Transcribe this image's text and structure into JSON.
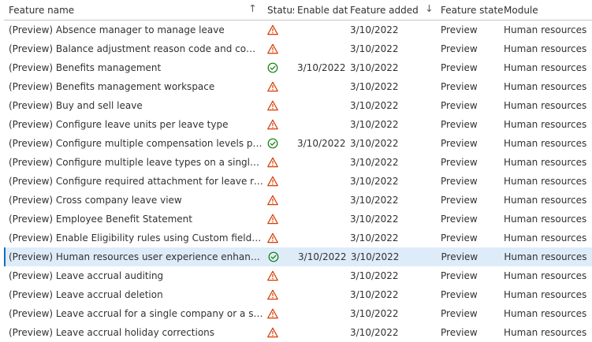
{
  "columns": {
    "name": "Feature name",
    "status": "Status",
    "enable_date": "Enable date",
    "feature_added": "Feature added",
    "feature_state": "Feature state",
    "module": "Module"
  },
  "colors": {
    "warning": "#d83b01",
    "success": "#107c10",
    "selected_row": "#deecf9"
  },
  "rows": [
    {
      "name": "(Preview) Absence manager to manage leave",
      "status": "warning",
      "enable_date": "",
      "added": "3/10/2022",
      "state": "Preview",
      "module": "Human resources"
    },
    {
      "name": "(Preview) Balance adjustment reason code and comment (...",
      "status": "warning",
      "enable_date": "",
      "added": "3/10/2022",
      "state": "Preview",
      "module": "Human resources"
    },
    {
      "name": "(Preview) Benefits management",
      "status": "success",
      "enable_date": "3/10/2022",
      "added": "3/10/2022",
      "state": "Preview",
      "module": "Human resources"
    },
    {
      "name": "(Preview) Benefits management workspace",
      "status": "warning",
      "enable_date": "",
      "added": "3/10/2022",
      "state": "Preview",
      "module": "Human resources"
    },
    {
      "name": "(Preview) Buy and sell leave",
      "status": "warning",
      "enable_date": "",
      "added": "3/10/2022",
      "state": "Preview",
      "module": "Human resources"
    },
    {
      "name": "(Preview) Configure leave units per leave type",
      "status": "warning",
      "enable_date": "",
      "added": "3/10/2022",
      "state": "Preview",
      "module": "Human resources"
    },
    {
      "name": "(Preview) Configure multiple compensation levels per job",
      "status": "success",
      "enable_date": "3/10/2022",
      "added": "3/10/2022",
      "state": "Preview",
      "module": "Human resources"
    },
    {
      "name": "(Preview) Configure multiple leave types on a single leave ...",
      "status": "warning",
      "enable_date": "",
      "added": "3/10/2022",
      "state": "Preview",
      "module": "Human resources"
    },
    {
      "name": "(Preview) Configure required attachment for leave requests",
      "status": "warning",
      "enable_date": "",
      "added": "3/10/2022",
      "state": "Preview",
      "module": "Human resources"
    },
    {
      "name": "(Preview) Cross company leave view",
      "status": "warning",
      "enable_date": "",
      "added": "3/10/2022",
      "state": "Preview",
      "module": "Human resources"
    },
    {
      "name": "(Preview) Employee Benefit Statement",
      "status": "warning",
      "enable_date": "",
      "added": "3/10/2022",
      "state": "Preview",
      "module": "Human resources"
    },
    {
      "name": "(Preview) Enable Eligibility rules using Custom fields in Ben...",
      "status": "warning",
      "enable_date": "",
      "added": "3/10/2022",
      "state": "Preview",
      "module": "Human resources"
    },
    {
      "name": "(Preview) Human resources user experience enhancements",
      "status": "success",
      "enable_date": "3/10/2022",
      "added": "3/10/2022",
      "state": "Preview",
      "module": "Human resources",
      "selected": true
    },
    {
      "name": "(Preview) Leave accrual auditing",
      "status": "warning",
      "enable_date": "",
      "added": "3/10/2022",
      "state": "Preview",
      "module": "Human resources"
    },
    {
      "name": "(Preview) Leave accrual deletion",
      "status": "warning",
      "enable_date": "",
      "added": "3/10/2022",
      "state": "Preview",
      "module": "Human resources"
    },
    {
      "name": "(Preview) Leave accrual for a single company or a single pl...",
      "status": "warning",
      "enable_date": "",
      "added": "3/10/2022",
      "state": "Preview",
      "module": "Human resources"
    },
    {
      "name": "(Preview) Leave accrual holiday corrections",
      "status": "warning",
      "enable_date": "",
      "added": "3/10/2022",
      "state": "Preview",
      "module": "Human resources"
    }
  ]
}
